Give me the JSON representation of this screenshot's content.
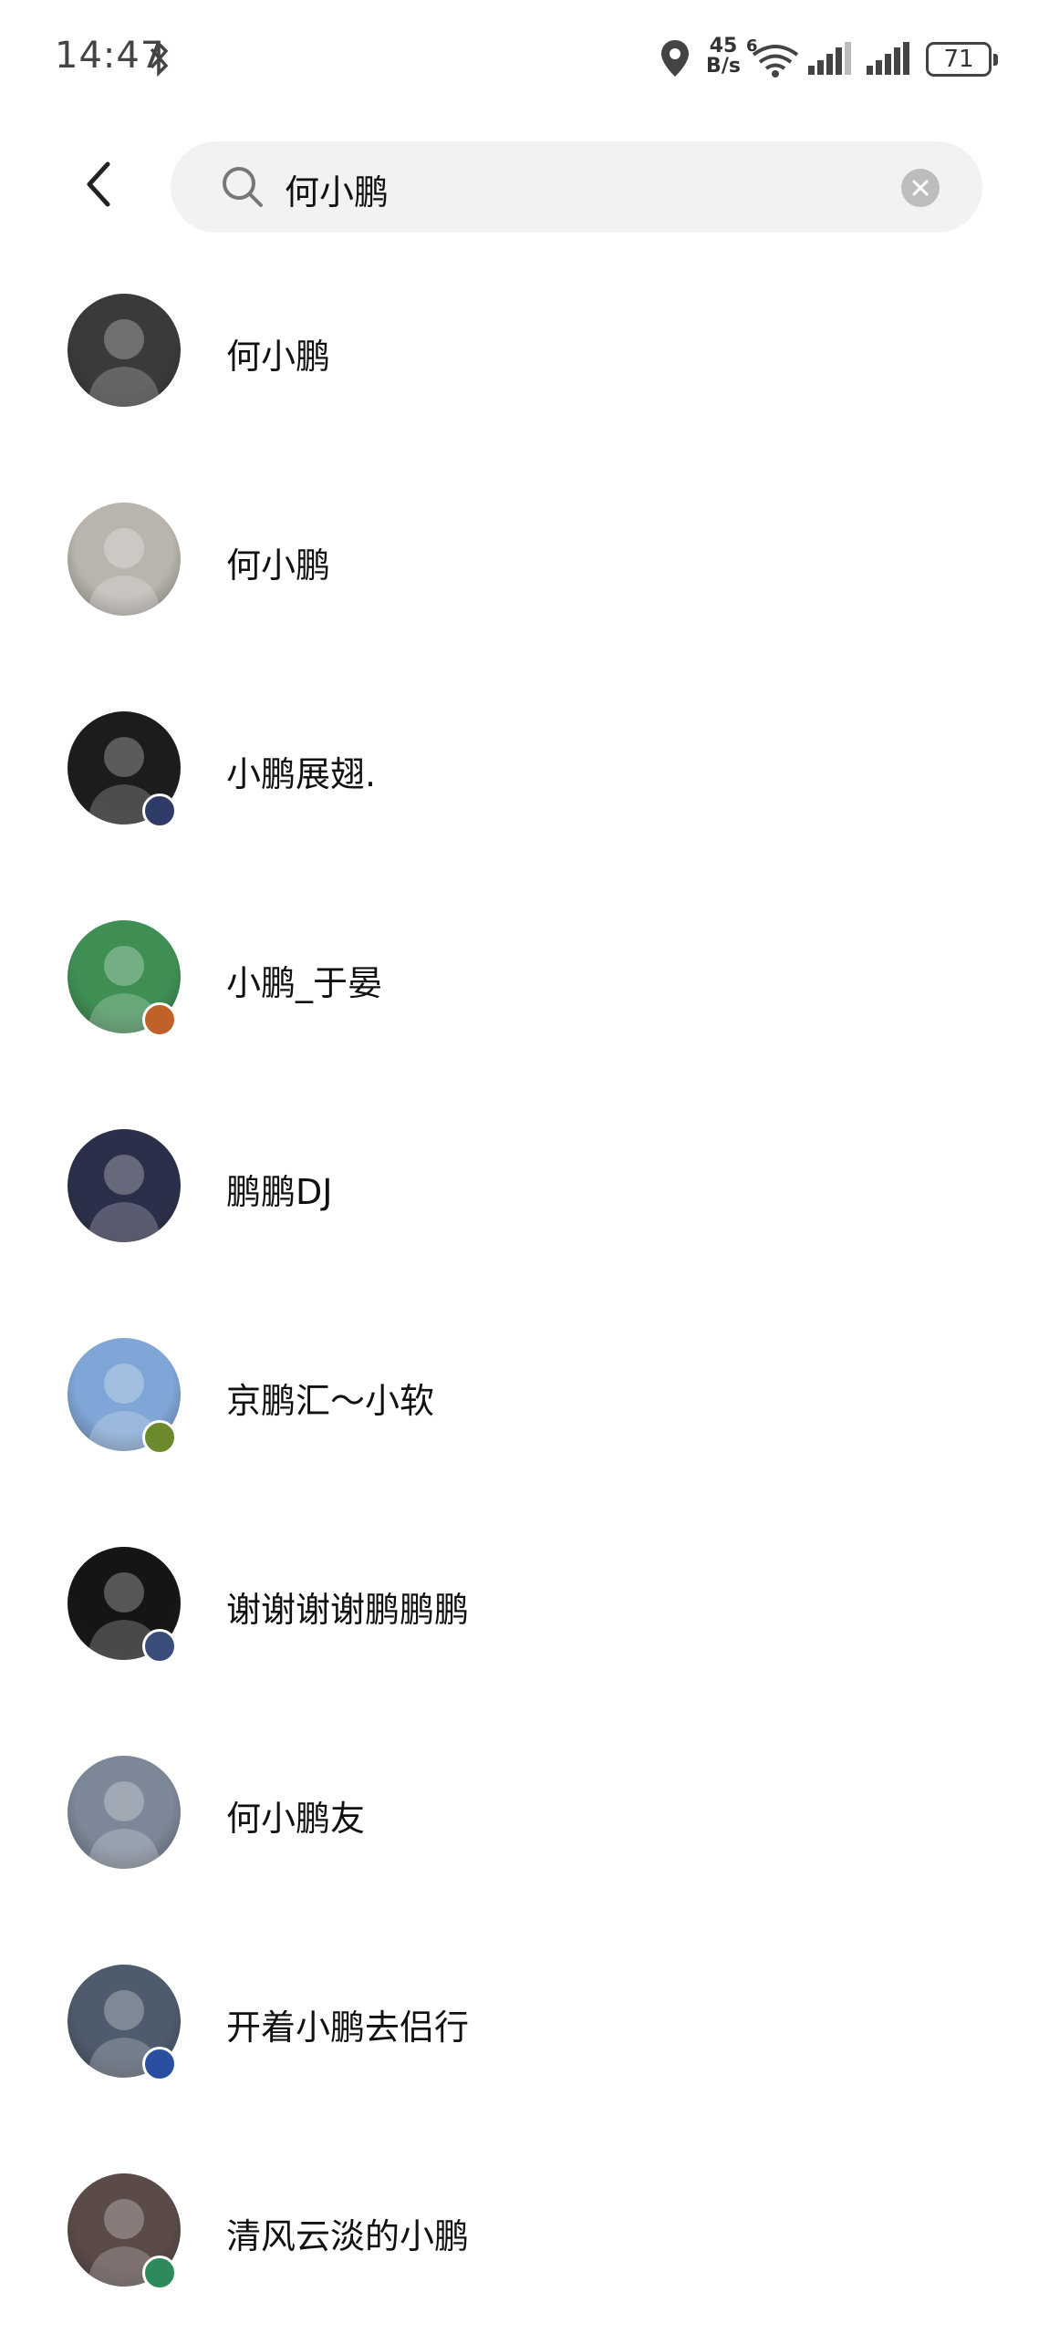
{
  "status_bar": {
    "time": "14:47",
    "net_speed_value": "45",
    "net_speed_unit": "B/s",
    "network_type": "6",
    "battery": "71"
  },
  "search": {
    "query": "何小鹏",
    "back_icon": "chevron-left-icon",
    "search_icon": "search-icon",
    "clear_icon": "clear-icon"
  },
  "results": [
    {
      "name": "何小鹏",
      "avatar_color": "#3a3a3a",
      "badge": null
    },
    {
      "name": "何小鹏",
      "avatar_color": "#b9b4ad",
      "badge": null
    },
    {
      "name": "小鹏展翅.",
      "avatar_color": "#1c1c1c",
      "badge": "#2d3b66"
    },
    {
      "name": "小鹏_于晏",
      "avatar_color": "#3f8f55",
      "badge": "#c0612a"
    },
    {
      "name": "鹏鹏DJ",
      "avatar_color": "#2b2f4a",
      "badge": null
    },
    {
      "name": "京鹏汇～小软",
      "avatar_color": "#7fa6d6",
      "badge": "#6b8a2c"
    },
    {
      "name": "谢谢谢谢鹏鹏鹏",
      "avatar_color": "#151515",
      "badge": "#3b4d7a"
    },
    {
      "name": "何小鹏友",
      "avatar_color": "#7c8798",
      "badge": null
    },
    {
      "name": "开着小鹏去侣行",
      "avatar_color": "#4e5b6c",
      "badge": "#2b4fa0"
    },
    {
      "name": "清风云淡的小鹏",
      "avatar_color": "#5a4a48",
      "badge": "#2e8a5a"
    }
  ]
}
